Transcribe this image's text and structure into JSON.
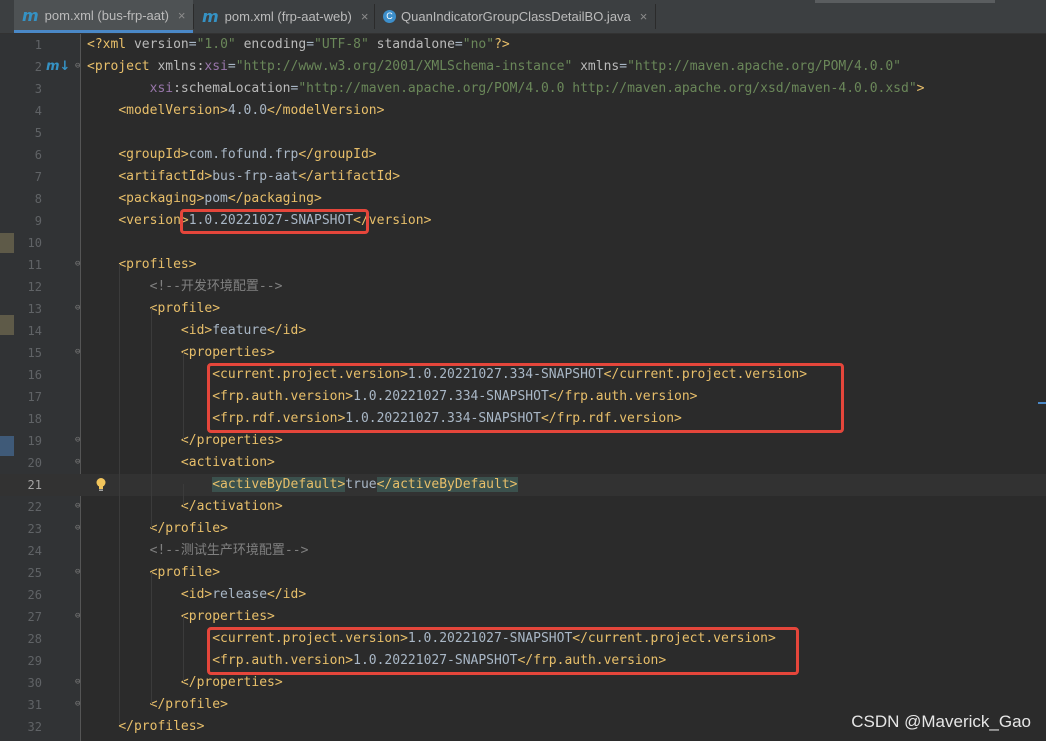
{
  "tabs": [
    {
      "icon": "maven-icon",
      "glyph": "m",
      "label": "pom.xml (bus-frp-aat)",
      "active": true
    },
    {
      "icon": "maven-icon",
      "glyph": "m",
      "label": "pom.xml (frp-aat-web)",
      "active": false
    },
    {
      "icon": "class-icon",
      "glyph": "C",
      "label": "QuanIndicatorGroupClassDetailBO.java",
      "active": false
    }
  ],
  "close_glyph": "×",
  "gutter_maven_glyph": "m↓",
  "lines": [
    {
      "n": "1",
      "html": "<span class=\"tag\">&lt;?xml </span><span class=\"attr\">version</span>=<span class=\"str\">\"1.0\"</span> <span class=\"attr\">encoding</span>=<span class=\"str\">\"UTF-8\"</span> <span class=\"attr\">standalone</span>=<span class=\"str\">\"no\"</span><span class=\"tag\">?&gt;</span>"
    },
    {
      "n": "2",
      "html": "<span class=\"tag\">&lt;project </span><span class=\"attr\">xmlns:</span><span class=\"ns\">xsi</span>=<span class=\"str\">\"http://www.w3.org/2001/XMLSchema-instance\"</span> <span class=\"attr\">xmlns</span>=<span class=\"str\">\"http://maven.apache.org/POM/4.0.0\"</span>"
    },
    {
      "n": "3",
      "html": "        <span class=\"ns\">xsi</span><span class=\"attr\">:schemaLocation</span>=<span class=\"str\">\"http://maven.apache.org/POM/4.0.0 http://maven.apache.org/xsd/maven-4.0.0.xsd\"</span><span class=\"tag\">&gt;</span>"
    },
    {
      "n": "4",
      "html": "    <span class=\"tag\">&lt;modelVersion&gt;</span>4.0.0<span class=\"tag\">&lt;/modelVersion&gt;</span>"
    },
    {
      "n": "5",
      "html": ""
    },
    {
      "n": "6",
      "html": "    <span class=\"tag\">&lt;groupId&gt;</span>com.fofund.frp<span class=\"tag\">&lt;/groupId&gt;</span>"
    },
    {
      "n": "7",
      "html": "    <span class=\"tag\">&lt;artifactId&gt;</span>bus-frp-aat<span class=\"tag\">&lt;/artifactId&gt;</span>"
    },
    {
      "n": "8",
      "html": "    <span class=\"tag\">&lt;packaging&gt;</span>pom<span class=\"tag\">&lt;/packaging&gt;</span>"
    },
    {
      "n": "9",
      "html": "    <span class=\"tag\">&lt;version&gt;</span>1.0.20221027-SNAPSHOT<span class=\"tag\">&lt;/version&gt;</span>"
    },
    {
      "n": "10",
      "html": ""
    },
    {
      "n": "11",
      "html": "    <span class=\"tag\">&lt;profiles&gt;</span>"
    },
    {
      "n": "12",
      "html": "        <span class=\"cmt\">&lt;!--开发环境配置--&gt;</span>"
    },
    {
      "n": "13",
      "html": "        <span class=\"tag\">&lt;profile&gt;</span>"
    },
    {
      "n": "14",
      "html": "            <span class=\"tag\">&lt;id&gt;</span>feature<span class=\"tag\">&lt;/id&gt;</span>"
    },
    {
      "n": "15",
      "html": "            <span class=\"tag\">&lt;properties&gt;</span>"
    },
    {
      "n": "16",
      "html": "                <span class=\"tag\">&lt;current.project.version&gt;</span>1.0.20221027.334-SNAPSHOT<span class=\"tag\">&lt;/current.project.version&gt;</span>"
    },
    {
      "n": "17",
      "html": "                <span class=\"tag\">&lt;frp.auth.version&gt;</span>1.0.20221027.334-SNAPSHOT<span class=\"tag\">&lt;/frp.auth.version&gt;</span>"
    },
    {
      "n": "18",
      "html": "                <span class=\"tag\">&lt;frp.rdf.version&gt;</span>1.0.20221027.334-SNAPSHOT<span class=\"tag\">&lt;/frp.rdf.version&gt;</span>"
    },
    {
      "n": "19",
      "html": "            <span class=\"tag\">&lt;/properties&gt;</span>"
    },
    {
      "n": "20",
      "html": "            <span class=\"tag\">&lt;activation&gt;</span>"
    },
    {
      "n": "21",
      "html": "                <span class=\"tag hl\">&lt;activeByDefault&gt;</span>true<span class=\"tag hl\">&lt;/activeByDefault&gt;</span>",
      "current": true
    },
    {
      "n": "22",
      "html": "            <span class=\"tag\">&lt;/activation&gt;</span>"
    },
    {
      "n": "23",
      "html": "        <span class=\"tag\">&lt;/profile&gt;</span>"
    },
    {
      "n": "24",
      "html": "        <span class=\"cmt\">&lt;!--测试生产环境配置--&gt;</span>"
    },
    {
      "n": "25",
      "html": "        <span class=\"tag\">&lt;profile&gt;</span>"
    },
    {
      "n": "26",
      "html": "            <span class=\"tag\">&lt;id&gt;</span>release<span class=\"tag\">&lt;/id&gt;</span>"
    },
    {
      "n": "27",
      "html": "            <span class=\"tag\">&lt;properties&gt;</span>"
    },
    {
      "n": "28",
      "html": "                <span class=\"tag\">&lt;current.project.version&gt;</span>1.0.20221027-SNAPSHOT<span class=\"tag\">&lt;/current.project.version&gt;</span>"
    },
    {
      "n": "29",
      "html": "                <span class=\"tag\">&lt;frp.auth.version&gt;</span>1.0.20221027-SNAPSHOT<span class=\"tag\">&lt;/frp.auth.version&gt;</span>"
    },
    {
      "n": "30",
      "html": "            <span class=\"tag\">&lt;/properties&gt;</span>"
    },
    {
      "n": "31",
      "html": "        <span class=\"tag\">&lt;/profile&gt;</span>"
    },
    {
      "n": "32",
      "html": "    <span class=\"tag\">&lt;/profiles&gt;</span>"
    }
  ],
  "watermark": "CSDN @Maverick_Gao",
  "colors": {
    "tag": "#e8bf6a",
    "string": "#6a8759",
    "comment": "#808080",
    "highlight_box": "#e5463b"
  }
}
